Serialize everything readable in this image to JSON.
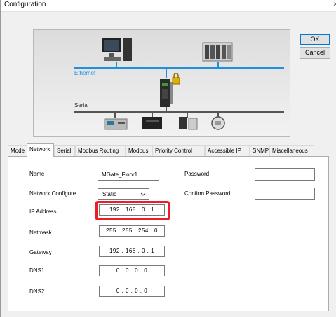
{
  "window": {
    "title": "Configuration",
    "close_glyph": "×"
  },
  "buttons": {
    "ok": "OK",
    "cancel": "Cancel"
  },
  "diagram": {
    "ethernet_label": "Ethernet",
    "serial_label": "Serial"
  },
  "tabs": [
    "Mode",
    "Network",
    "Serial",
    "Modbus Routing",
    "Modbus",
    "Priority Control",
    "Accessible IP",
    "SNMP",
    "Miscellaneous"
  ],
  "active_tab": "Network",
  "form": {
    "name_label": "Name",
    "name_value": "MGate_Floor1",
    "network_configure_label": "Network Configure",
    "network_configure_value": "Static",
    "ip_address_label": "IP Address",
    "ip_address_value": "192 . 168 . 0 . 1",
    "netmask_label": "Netmask",
    "netmask_value": "255 . 255 . 254 . 0",
    "gateway_label": "Gateway",
    "gateway_value": "192 . 168 . 0 . 1",
    "dns1_label": "DNS1",
    "dns1_value": "0 . 0 . 0 . 0",
    "dns2_label": "DNS2",
    "dns2_value": "0 . 0 . 0 . 0",
    "password_label": "Password",
    "password_value": "",
    "confirm_password_label": "Confirm Password",
    "confirm_password_value": ""
  },
  "colors": {
    "ethernet_line": "#1f8fe0",
    "highlight_border": "#ee1c25"
  }
}
